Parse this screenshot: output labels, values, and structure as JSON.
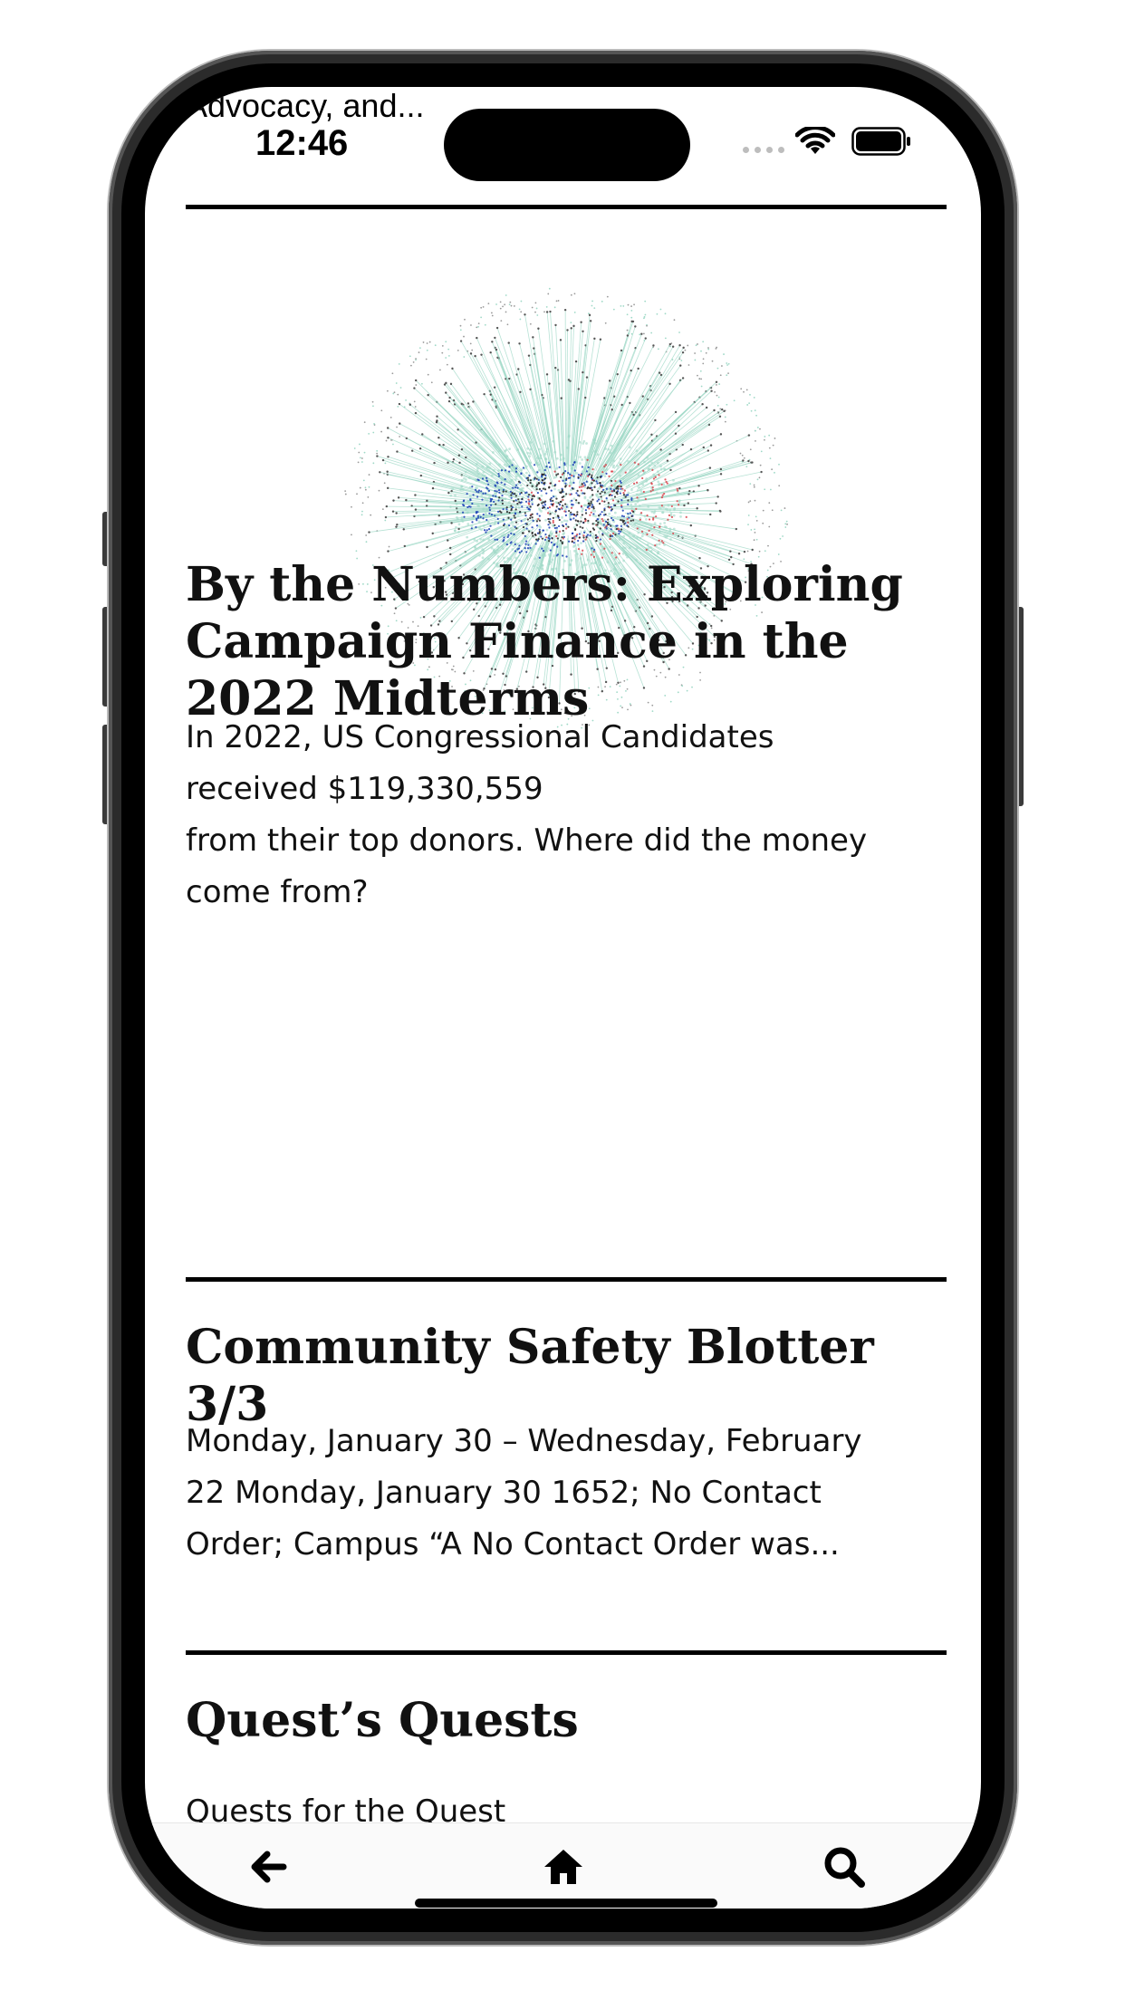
{
  "status_bar": {
    "previous_title": "Advocacy, and...",
    "time": "12:46"
  },
  "articles": [
    {
      "title": "By the Numbers: Exploring Campaign Finance in the 2022 Midterms",
      "excerpt": "In 2022, US Congressional Candidates\nreceived $119,330,559\nfrom their top donors. Where did the money\ncome from?",
      "image": "campaign-finance-network-graph"
    },
    {
      "title": "Community Safety Blotter 3/3",
      "excerpt": "Monday, January 30 – Wednesday, February\n22 Monday, January 30 1652; No Contact\nOrder; Campus “A No Contact Order was..."
    },
    {
      "title": "Quest’s Quests",
      "excerpt": "Quests for the Quest"
    }
  ],
  "bottom_nav": {
    "back_icon": "arrow-left-icon",
    "home_icon": "home-icon",
    "search_icon": "search-icon"
  },
  "colors": {
    "graph_teal": "#9fd9c7",
    "graph_blue": "#1a3fb5",
    "graph_red": "#d9434b",
    "graph_dark": "#222222"
  }
}
